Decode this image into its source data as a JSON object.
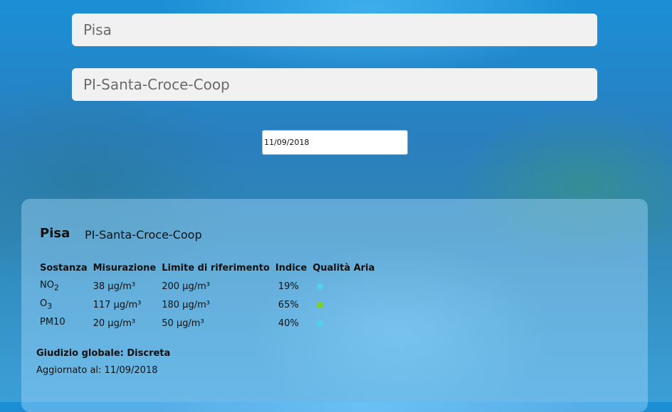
{
  "form": {
    "city_value": "Pisa",
    "station_value": "PI-Santa-Croce-Coop",
    "date_value": "11/09/2018"
  },
  "result": {
    "city": "Pisa",
    "station": "PI-Santa-Croce-Coop",
    "headers": [
      "Sostanza",
      "Misurazione",
      "Limite di riferimento",
      "Indice",
      "Qualità Aria"
    ],
    "rows": [
      {
        "substance": "NO",
        "sub": "2",
        "measurement": "38 µg/m³",
        "limit": "200 µg/m³",
        "index": "19%",
        "quality_color": "#4fd2ea"
      },
      {
        "substance": "O",
        "sub": "3",
        "measurement": "117 µg/m³",
        "limit": "180 µg/m³",
        "index": "65%",
        "quality_color": "#7ed321"
      },
      {
        "substance": "PM10",
        "sub": "",
        "measurement": "20 µg/m³",
        "limit": "50 µg/m³",
        "index": "40%",
        "quality_color": "#4fd2ea"
      }
    ],
    "overall_label": "Giudizio globale: Discreta",
    "updated_label": "Aggiornato al: 11/09/2018"
  }
}
